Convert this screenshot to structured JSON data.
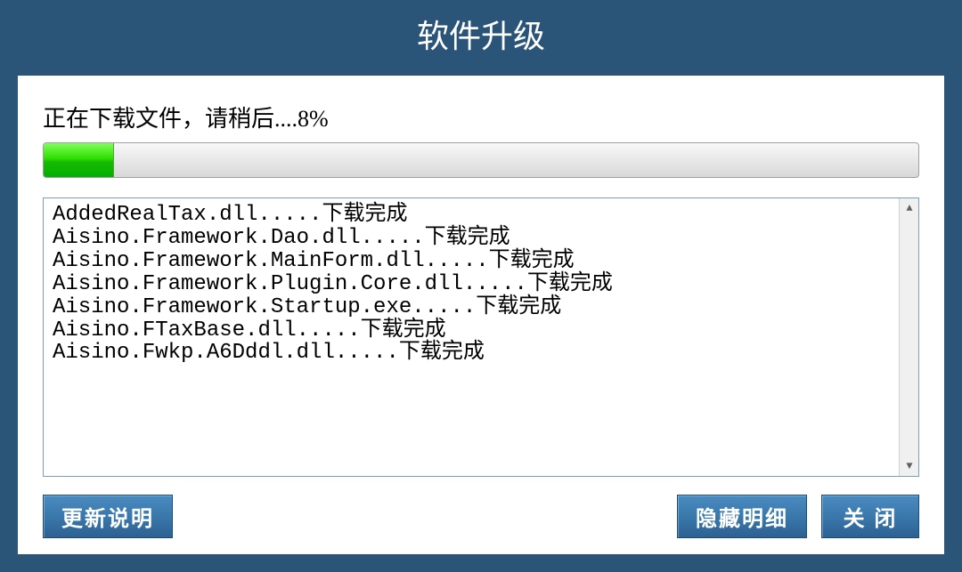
{
  "titlebar": {
    "title": "软件升级"
  },
  "status": {
    "prefix": "正在下载文件，请稍后....",
    "percent_text": "8%"
  },
  "progress": {
    "percent": 8
  },
  "log": {
    "lines": [
      "AddedRealTax.dll.....下载完成",
      "Aisino.Framework.Dao.dll.....下载完成",
      "Aisino.Framework.MainForm.dll.....下载完成",
      "Aisino.Framework.Plugin.Core.dll.....下载完成",
      "Aisino.Framework.Startup.exe.....下载完成",
      "Aisino.FTaxBase.dll.....下载完成",
      "Aisino.Fwkp.A6Dddl.dll.....下载完成"
    ]
  },
  "buttons": {
    "update_info": "更新说明",
    "hide_details": "隐藏明细",
    "close": "关 闭"
  },
  "scroll": {
    "up_glyph": "▲",
    "down_glyph": "▼"
  }
}
